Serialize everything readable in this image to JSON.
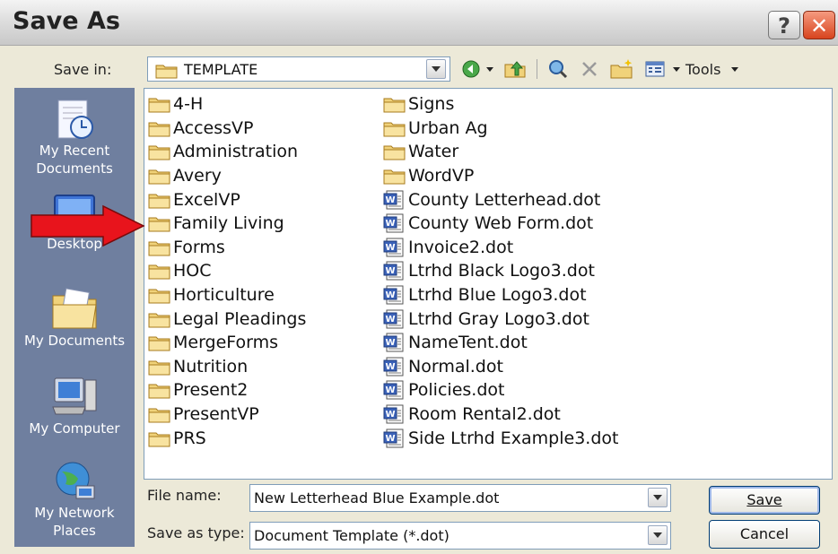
{
  "window": {
    "title": "Save As"
  },
  "toolbar": {
    "save_in_label": "Save in:",
    "save_in_value": "TEMPLATE",
    "tools_label": "Tools"
  },
  "places": [
    {
      "id": "my-recent-documents",
      "label_lines": [
        "My Recent",
        "Documents"
      ],
      "icon": "recent-documents-icon"
    },
    {
      "id": "desktop",
      "label_lines": [
        "Desktop"
      ],
      "icon": "desktop-icon"
    },
    {
      "id": "my-documents",
      "label_lines": [
        "My Documents"
      ],
      "icon": "my-documents-icon"
    },
    {
      "id": "my-computer",
      "label_lines": [
        "My Computer"
      ],
      "icon": "my-computer-icon"
    },
    {
      "id": "my-network-places",
      "label_lines": [
        "My Network",
        "Places"
      ],
      "icon": "network-places-icon"
    }
  ],
  "files": {
    "column1": [
      {
        "name": "4-H",
        "type": "folder"
      },
      {
        "name": "AccessVP",
        "type": "folder"
      },
      {
        "name": "Administration",
        "type": "folder"
      },
      {
        "name": "Avery",
        "type": "folder"
      },
      {
        "name": "ExcelVP",
        "type": "folder"
      },
      {
        "name": "Family Living",
        "type": "folder"
      },
      {
        "name": "Forms",
        "type": "folder"
      },
      {
        "name": "HOC",
        "type": "folder"
      },
      {
        "name": "Horticulture",
        "type": "folder"
      },
      {
        "name": "Legal Pleadings",
        "type": "folder"
      },
      {
        "name": "MergeForms",
        "type": "folder"
      },
      {
        "name": "Nutrition",
        "type": "folder"
      },
      {
        "name": "Present2",
        "type": "folder"
      },
      {
        "name": "PresentVP",
        "type": "folder"
      },
      {
        "name": "PRS",
        "type": "folder"
      }
    ],
    "column2": [
      {
        "name": "Signs",
        "type": "folder"
      },
      {
        "name": "Urban Ag",
        "type": "folder"
      },
      {
        "name": "Water",
        "type": "folder"
      },
      {
        "name": "WordVP",
        "type": "folder"
      },
      {
        "name": "County Letterhead.dot",
        "type": "word-template"
      },
      {
        "name": "County Web Form.dot",
        "type": "word-template"
      },
      {
        "name": "Invoice2.dot",
        "type": "word-template"
      },
      {
        "name": "Ltrhd Black Logo3.dot",
        "type": "word-template"
      },
      {
        "name": "Ltrhd Blue Logo3.dot",
        "type": "word-template"
      },
      {
        "name": "Ltrhd Gray Logo3.dot",
        "type": "word-template"
      },
      {
        "name": "NameTent.dot",
        "type": "word-template"
      },
      {
        "name": "Normal.dot",
        "type": "word-template"
      },
      {
        "name": "Policies.dot",
        "type": "word-template"
      },
      {
        "name": "Room Rental2.dot",
        "type": "word-template"
      },
      {
        "name": "Side Ltrhd Example3.dot",
        "type": "word-template"
      }
    ]
  },
  "form": {
    "file_name_label": "File name:",
    "file_name_value": "New Letterhead Blue Example.dot",
    "save_as_type_label": "Save as type:",
    "save_as_type_value": "Document Template (*.dot)"
  },
  "buttons": {
    "save": "Save",
    "cancel": "Cancel"
  },
  "colors": {
    "places_bar": "#6f7f9f",
    "dialog_bg": "#ece9d8",
    "arrow": "#e8141c",
    "close_button": "#d8441e"
  }
}
